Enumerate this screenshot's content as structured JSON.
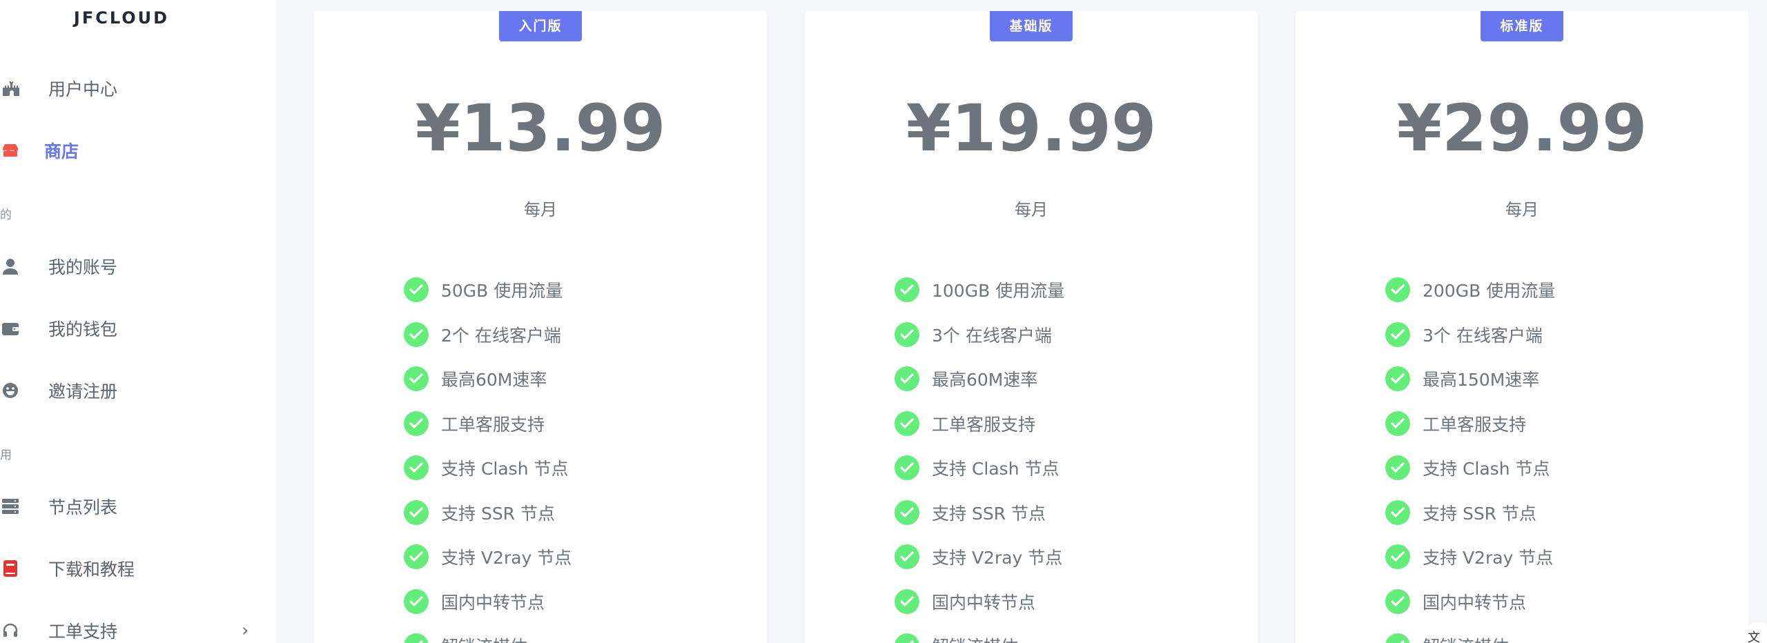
{
  "sidebar": {
    "brand": "JFCLOUD",
    "items": [
      {
        "label": "用户中心",
        "icon": "castle-icon",
        "active": false
      },
      {
        "label": "商店",
        "icon": "store-icon",
        "active": true
      },
      {
        "label": "我的账号",
        "icon": "user-icon",
        "active": false
      },
      {
        "label": "我的钱包",
        "icon": "wallet-icon",
        "active": false
      },
      {
        "label": "邀请注册",
        "icon": "laugh-icon",
        "active": false
      },
      {
        "label": "节点列表",
        "icon": "server-icon",
        "active": false
      },
      {
        "label": "下载和教程",
        "icon": "book-icon",
        "active": false
      },
      {
        "label": "工单支持",
        "icon": "headset-icon",
        "active": false,
        "has_submenu": true
      }
    ],
    "section_headers": [
      "的",
      "用"
    ]
  },
  "plans": [
    {
      "badge": "入门版",
      "price": "¥13.99",
      "period": "每月",
      "features": [
        "50GB 使用流量",
        "2个 在线客户端",
        "最高60M速率",
        "工单客服支持",
        "支持 Clash 节点",
        "支持 SSR 节点",
        "支持 V2ray 节点",
        "国内中转节点",
        "解锁流媒体"
      ]
    },
    {
      "badge": "基础版",
      "price": "¥19.99",
      "period": "每月",
      "features": [
        "100GB 使用流量",
        "3个 在线客户端",
        "最高60M速率",
        "工单客服支持",
        "支持 Clash 节点",
        "支持 SSR 节点",
        "支持 V2ray 节点",
        "国内中转节点",
        "解锁流媒体"
      ]
    },
    {
      "badge": "标准版",
      "price": "¥29.99",
      "period": "每月",
      "features": [
        "200GB 使用流量",
        "3个 在线客户端",
        "最高150M速率",
        "工单客服支持",
        "支持 Clash 节点",
        "支持 SSR 节点",
        "支持 V2ray 节点",
        "国内中转节点",
        "解锁流媒体"
      ]
    }
  ],
  "colors": {
    "accent": "#6777ef",
    "check": "#63ed7a",
    "muted_text": "#6c757d",
    "store_icon": "#fc544b",
    "book_icon": "#e3342f"
  },
  "corner_icon": "translate-icon"
}
